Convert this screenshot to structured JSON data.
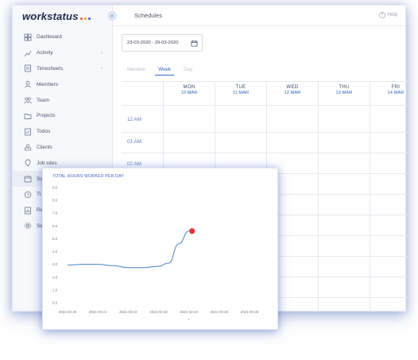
{
  "app": {
    "logo_text": "workstatus",
    "logo_dot_colors": [
      "#f05a28",
      "#f7a21b",
      "#3266c7"
    ],
    "collapse_icon": "chevron-left-double-icon"
  },
  "sidebar": {
    "items": [
      {
        "label": "Dashboard",
        "icon": "dashboard-icon",
        "has_chevron": false
      },
      {
        "label": "Activity",
        "icon": "activity-icon",
        "has_chevron": true
      },
      {
        "label": "Timesheets",
        "icon": "timesheets-icon",
        "has_chevron": true
      },
      {
        "label": "Members",
        "icon": "user-icon",
        "has_chevron": false
      },
      {
        "label": "Team",
        "icon": "team-icon",
        "has_chevron": false
      },
      {
        "label": "Projects",
        "icon": "projects-icon",
        "has_chevron": false
      },
      {
        "label": "Todos",
        "icon": "todos-icon",
        "has_chevron": false
      },
      {
        "label": "Clients",
        "icon": "clients-icon",
        "has_chevron": false
      },
      {
        "label": "Job sites",
        "icon": "job-sites-icon",
        "has_chevron": false
      },
      {
        "label": "Sc",
        "icon": "calendar-icon",
        "has_chevron": false,
        "active": true
      },
      {
        "label": "Ti",
        "icon": "clock-icon",
        "has_chevron": false
      },
      {
        "label": "Re",
        "icon": "reports-icon",
        "has_chevron": false
      },
      {
        "label": "Se",
        "icon": "settings-icon",
        "has_chevron": false
      }
    ]
  },
  "header": {
    "title": "Schedules",
    "help_label": "Help",
    "help_icon": "help-circle-icon"
  },
  "toolbar": {
    "date_range": "23-03-2020 - 29-03-2020",
    "calendar_icon": "calendar-icon"
  },
  "view_tabs": [
    {
      "label": "Member",
      "active": false
    },
    {
      "label": "Week",
      "active": true
    },
    {
      "label": "Day",
      "active": false
    }
  ],
  "schedule": {
    "days": [
      {
        "dow": "MON",
        "date": "10 MAR"
      },
      {
        "dow": "TUE",
        "date": "11 MAR"
      },
      {
        "dow": "WED",
        "date": "12 MAR"
      },
      {
        "dow": "THU",
        "date": "13 MAR"
      },
      {
        "dow": "FRI",
        "date": "14 MAR"
      }
    ],
    "hours": [
      "12 AM",
      "01 AM",
      "02 AM"
    ]
  },
  "colors": {
    "accent": "#3266c7",
    "line": "#4a7fd1",
    "marker": "#e0343a"
  },
  "chart_data": {
    "type": "line",
    "title": "TOTAL HOURS WORKED PER DAY",
    "xlabel": "",
    "ylabel": "",
    "ylim": [
      0,
      9
    ],
    "yticks": [
      "0.0",
      "1.0",
      "2.0",
      "3.0",
      "4.0",
      "5.0",
      "6.0",
      "7.0",
      "8.0",
      "9.0"
    ],
    "categories": [
      "2021-03-20",
      "2021-03-21",
      "2021-03-22",
      "2021-03-23",
      "2021-03-24",
      "2021-03-25",
      "2021-03-26"
    ],
    "x": [
      "2021-03-20",
      "2021-03-20",
      "2021-03-21",
      "2021-03-21",
      "2021-03-22",
      "2021-03-22",
      "2021-03-23",
      "2021-03-23",
      "2021-03-23",
      "2021-03-24"
    ],
    "values": [
      2.95,
      3.0,
      3.0,
      2.9,
      2.75,
      2.75,
      2.85,
      3.1,
      4.6,
      5.6
    ],
    "highlight": {
      "x": "2021-03-24",
      "value": 5.6
    },
    "grid": true,
    "legend": "none"
  }
}
